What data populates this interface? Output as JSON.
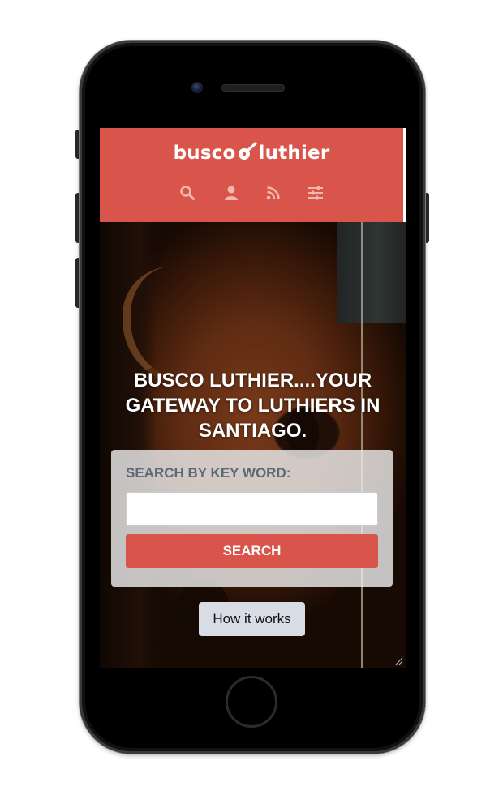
{
  "header": {
    "logo_prefix": "busco",
    "logo_suffix": "luthier",
    "nav": [
      {
        "icon": "search-icon"
      },
      {
        "icon": "user-icon"
      },
      {
        "icon": "rss-icon"
      },
      {
        "icon": "filter-sliders-icon"
      }
    ]
  },
  "hero": {
    "tagline": "BUSCO LUTHIER....YOUR GATEWAY TO LUTHIERS IN SANTIAGO.",
    "search": {
      "label": "SEARCH BY KEY WORD:",
      "value": "",
      "placeholder": "",
      "button_label": "SEARCH"
    },
    "how_button_label": "How it works"
  },
  "colors": {
    "brand": "#d9554b",
    "nav_icon": "#f2b7ad",
    "label": "#5c6a72",
    "secondary_button": "#d8dce4"
  }
}
